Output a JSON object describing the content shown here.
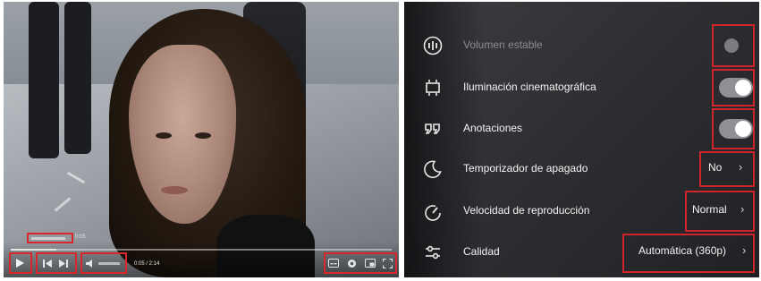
{
  "player": {
    "mini_labels": {
      "top": "0:05",
      "time": "0:05 / 2:14"
    },
    "progress": 0.12,
    "controls": {
      "play_icon": "play-icon",
      "prev_icon": "skip-previous-icon",
      "next_icon": "skip-next-icon",
      "volume_icon": "volume-icon",
      "settings_icon": "settings-icon",
      "subtitles_icon": "subtitles-icon",
      "miniplayer_icon": "miniplayer-icon",
      "fullscreen_icon": "fullscreen-icon"
    }
  },
  "settings_menu": {
    "items": [
      {
        "icon": "stable-volume-icon",
        "label": "Volumen estable",
        "control": "toggle",
        "state": "off",
        "disabled": true
      },
      {
        "icon": "ambient-mode-icon",
        "label": "Iluminación cinematográfica",
        "control": "toggle",
        "state": "on"
      },
      {
        "icon": "annotations-icon",
        "label": "Anotaciones",
        "control": "toggle",
        "state": "on"
      },
      {
        "icon": "sleep-timer-icon",
        "label": "Temporizador de apagado",
        "control": "value",
        "value": "No"
      },
      {
        "icon": "playback-speed-icon",
        "label": "Velocidad de reproducción",
        "control": "value",
        "value": "Normal"
      },
      {
        "icon": "quality-icon",
        "label": "Calidad",
        "control": "value",
        "value": "Automática (360p)"
      }
    ]
  },
  "colors": {
    "highlight": "#d1232a",
    "menu_bg": "#2c2e31",
    "toggle_on_track": "#8e9094"
  }
}
